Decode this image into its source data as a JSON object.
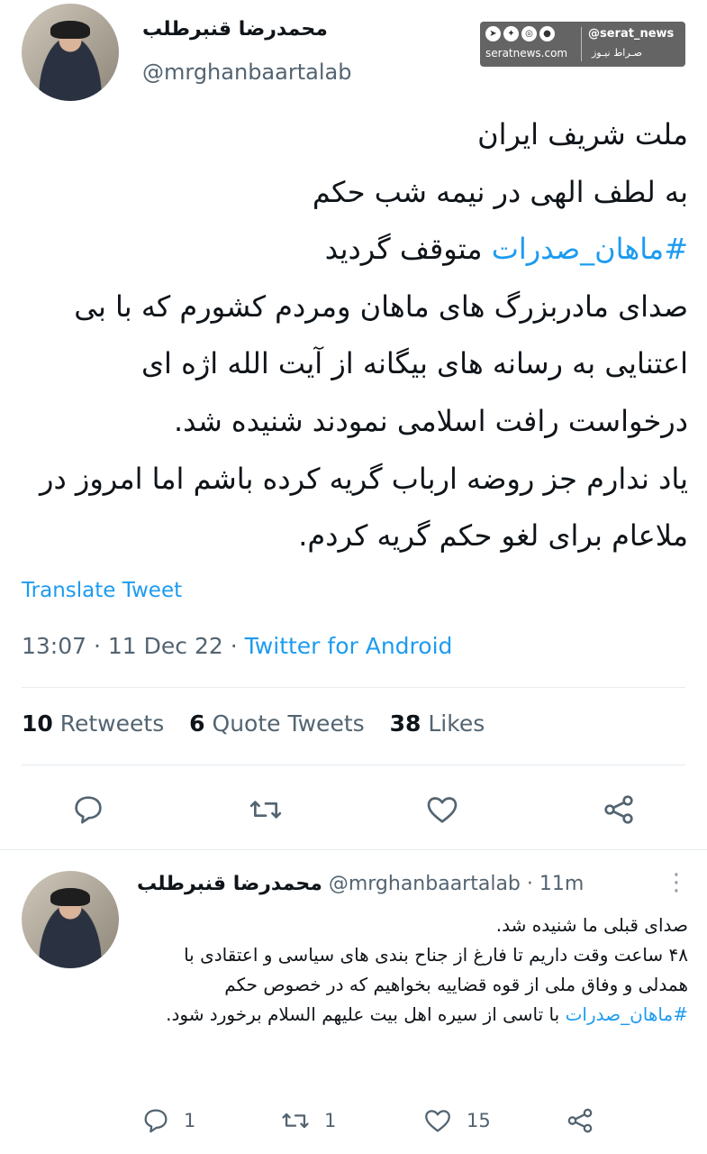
{
  "main_tweet": {
    "author_name": "محمدرضا قنبرطلب",
    "handle": "@mrghanbaartalab",
    "text_before_hashtag": "ملت شریف ایران\nبه لطف الهی در نیمه شب حکم\n",
    "hashtag": "#ماهان_صدرات",
    "text_after_hashtag": " متوقف گردید\nصدای مادربزرگ های ماهان ومردم کشورم که با بی اعتنایی به رسانه های بیگانه از آیت الله اژه ای درخواست رافت اسلامی نمودند شنیده شد.\nیاد ندارم جز روضه ارباب گریه کرده باشم اما امروز در ملاعام برای لغو حکم گریه کردم.",
    "translate_label": "Translate Tweet",
    "time": "13:07",
    "separator": "·",
    "date": "11 Dec 22",
    "source": "Twitter for Android",
    "stats": {
      "retweets_count": "10",
      "retweets_label": "Retweets",
      "quotes_count": "6",
      "quotes_label": "Quote Tweets",
      "likes_count": "38",
      "likes_label": "Likes"
    }
  },
  "watermark": {
    "handle": "@serat_news",
    "site": "seratnews.com",
    "brand": "صـراط نیـوز"
  },
  "reply_tweet": {
    "author_name": "محمدرضا قنبرطلب",
    "handle": "@mrghanbaartalab",
    "separator": "·",
    "time_ago": "11m",
    "more_icon": "⋮",
    "text_before_hashtag": "صدای قبلی ما شنیده شد.\n۴۸ ساعت وقت داریم تا فارغ از جناح بندی های سیاسی و اعتقادی با همدلی و وفاق ملی از قوه قضاییه بخواهیم که در خصوص حکم ",
    "hashtag": "#ماهان_صدرات",
    "text_after_hashtag": " با تاسی از سیره اهل بیت علیهم السلام برخورد شود.",
    "reply_count": "1",
    "retweet_count": "1",
    "like_count": "15"
  }
}
